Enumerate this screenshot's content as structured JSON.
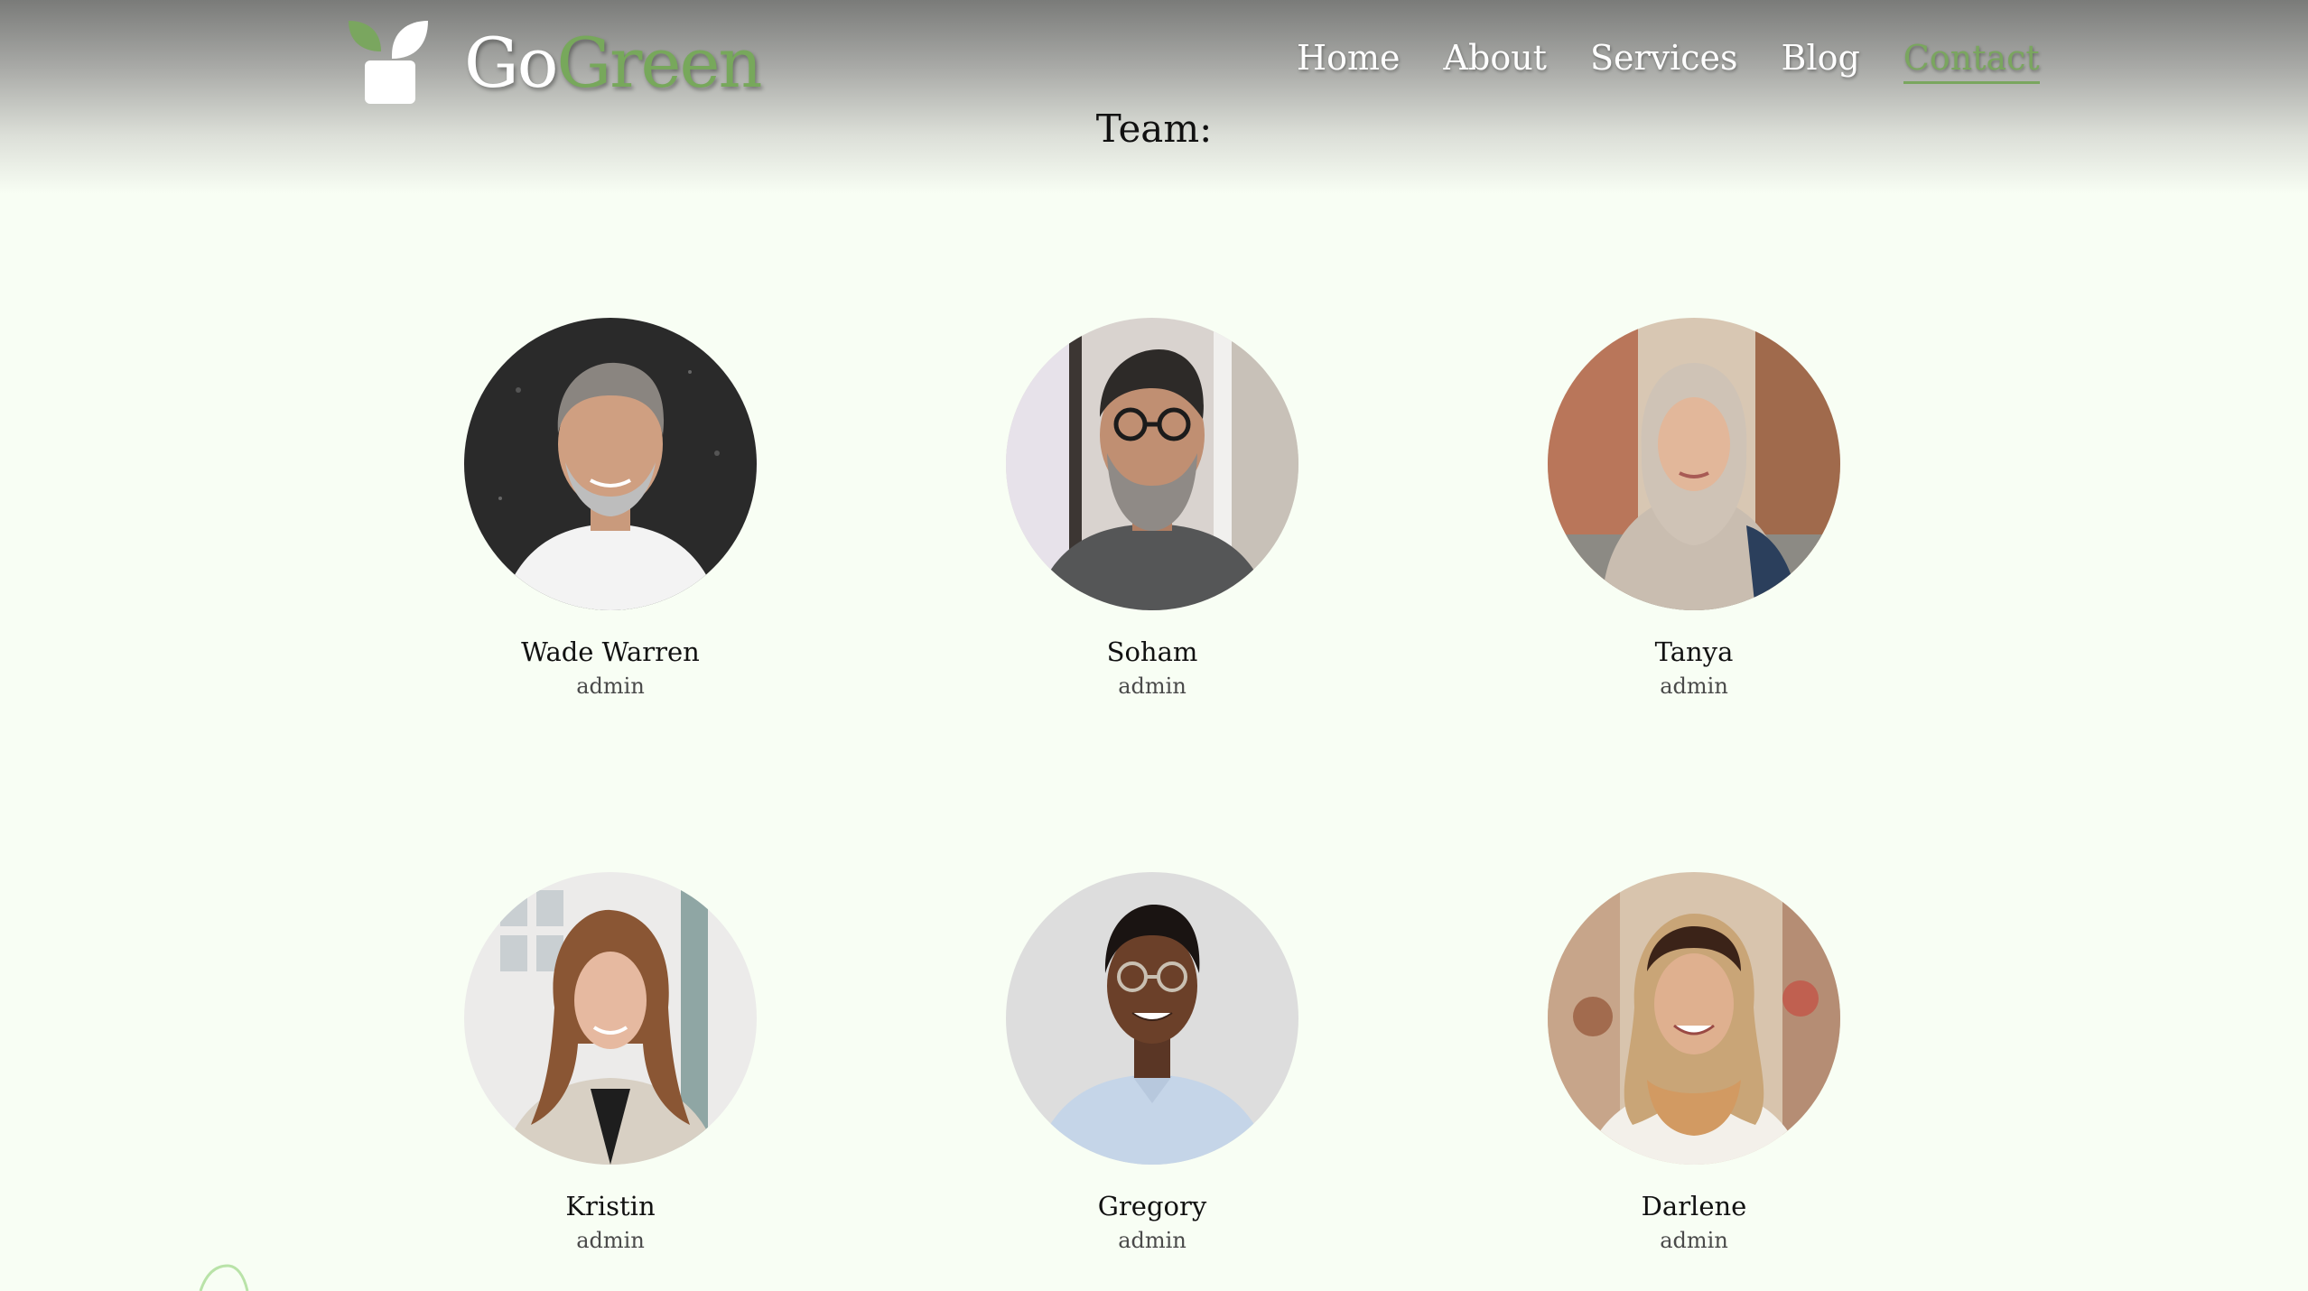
{
  "brand": {
    "name_part1": "Go",
    "name_part2": "Green",
    "accent_color": "#77a85b"
  },
  "nav": {
    "items": [
      {
        "label": "Home",
        "active": false
      },
      {
        "label": "About",
        "active": false
      },
      {
        "label": "Services",
        "active": false
      },
      {
        "label": "Blog",
        "active": false
      },
      {
        "label": "Contact",
        "active": true
      }
    ]
  },
  "team": {
    "heading": "Team:",
    "members": [
      {
        "name": "Wade Warren",
        "role": "admin"
      },
      {
        "name": "Soham",
        "role": "admin"
      },
      {
        "name": "Tanya",
        "role": "admin"
      },
      {
        "name": "Kristin",
        "role": "admin"
      },
      {
        "name": "Gregory",
        "role": "admin"
      },
      {
        "name": "Darlene",
        "role": "admin"
      }
    ]
  }
}
